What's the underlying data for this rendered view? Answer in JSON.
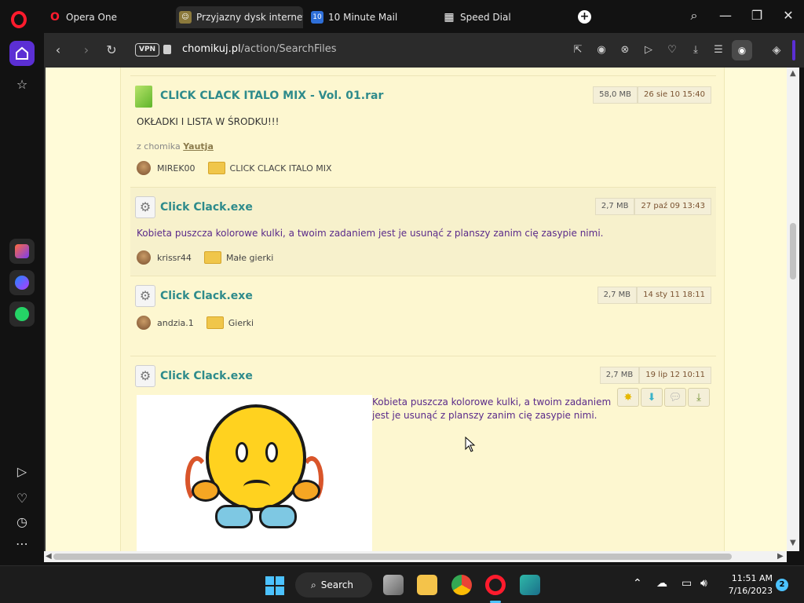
{
  "browser": {
    "tabs": [
      {
        "label": "Opera One"
      },
      {
        "label": "Przyjazny dysk internetow"
      },
      {
        "label": "10 Minute Mail"
      },
      {
        "label": "Speed Dial"
      }
    ],
    "vpn_label": "VPN",
    "url_host": "chomikuj.pl",
    "url_path": "/action/SearchFiles"
  },
  "files": [
    {
      "title": "CLICK CLACK ITALO MIX - Vol. 01.rar",
      "size": "58,0 MB",
      "date": "26 sie 10 15:40",
      "description": "OKŁADKI I LISTA W ŚRODKU!!!",
      "from_prefix": "z chomika",
      "from_user": "Yautja",
      "user": "MIREK00",
      "folder": "CLICK CLACK ITALO MIX"
    },
    {
      "title": "Click Clack.exe",
      "size": "2,7 MB",
      "date": "27 paź 09 13:43",
      "description": "Kobieta puszcza kolorowe kulki, a twoim zadaniem jest je usunąć z planszy zanim cię zasypie nimi.",
      "user": "krissr44",
      "folder": "Małe gierki"
    },
    {
      "title": "Click Clack.exe",
      "size": "2,7 MB",
      "date": "14 sty 11 18:11",
      "user": "andzia.1",
      "folder": "Gierki"
    },
    {
      "title": "Click Clack.exe",
      "size": "2,7 MB",
      "date": "19 lip 12 10:11",
      "description": "Kobieta puszcza kolorowe kulki, a twoim zadaniem jest je usunąć z planszy zanim cię zasypie nimi."
    }
  ],
  "taskbar": {
    "search_label": "Search",
    "time": "11:51 AM",
    "date": "7/16/2023",
    "notifications": "2"
  },
  "colors": {
    "accent": "#5b2fd4",
    "title_teal": "#2e8b8b",
    "page_bg": "#fffbd8",
    "opera_red": "#ff1b2d",
    "windows_blue": "#4cc2ff"
  }
}
